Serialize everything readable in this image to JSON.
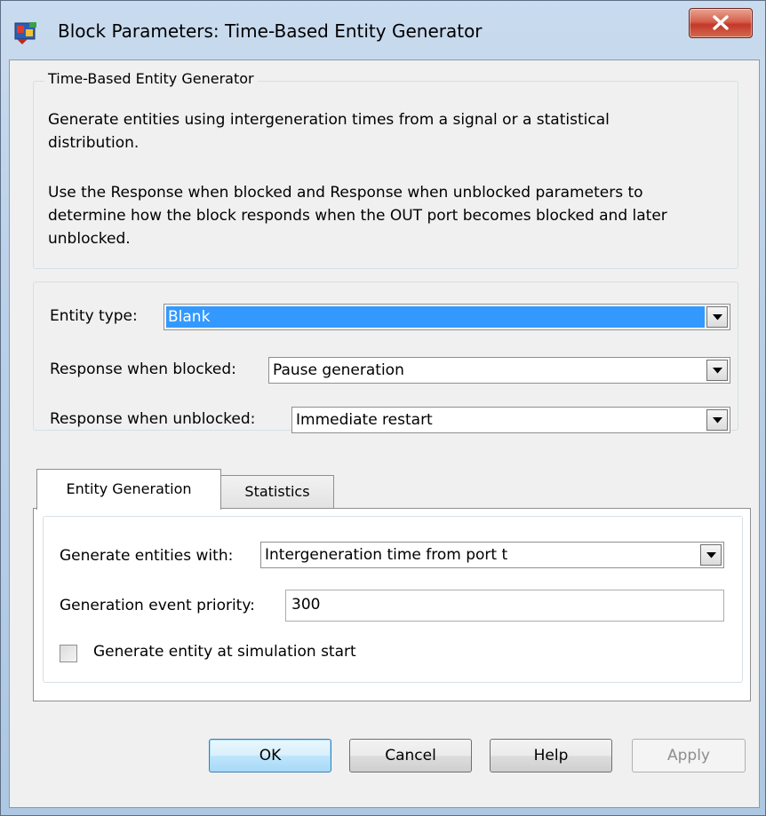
{
  "window": {
    "title": "Block Parameters: Time-Based Entity Generator",
    "close_icon": "close-x-icon",
    "app_icon": "simulink-block-icon"
  },
  "description": {
    "group_title": "Time-Based Entity Generator",
    "paragraph1_line1": "Generate entities using intergeneration times from a signal or a statistical",
    "paragraph1_line2": "distribution.",
    "paragraph2_line1": "Use the Response when blocked and Response when unblocked parameters to",
    "paragraph2_line2": "determine how the block responds when the OUT port becomes blocked and later",
    "paragraph2_line3": "unblocked."
  },
  "params": {
    "entity_type_label": "Entity type:",
    "entity_type_value": "Blank",
    "blocked_label": "Response when blocked:",
    "blocked_value": "Pause generation",
    "unblocked_label": "Response when unblocked:",
    "unblocked_value": "Immediate restart"
  },
  "tabs": [
    {
      "label": "Entity Generation",
      "active": true
    },
    {
      "label": "Statistics",
      "active": false
    }
  ],
  "entity_generation": {
    "generate_with_label": "Generate entities with:",
    "generate_with_value": "Intergeneration time from port t",
    "priority_label": "Generation event priority:",
    "priority_value": "300",
    "start_checkbox_label": "Generate entity at simulation start",
    "start_checkbox_checked": false
  },
  "buttons": {
    "ok": "OK",
    "cancel": "Cancel",
    "help": "Help",
    "apply": "Apply",
    "apply_enabled": false
  },
  "colors": {
    "selection": "#3399ff",
    "close_button": "#c3382a",
    "dialog_bg": "#f0f0f0"
  }
}
